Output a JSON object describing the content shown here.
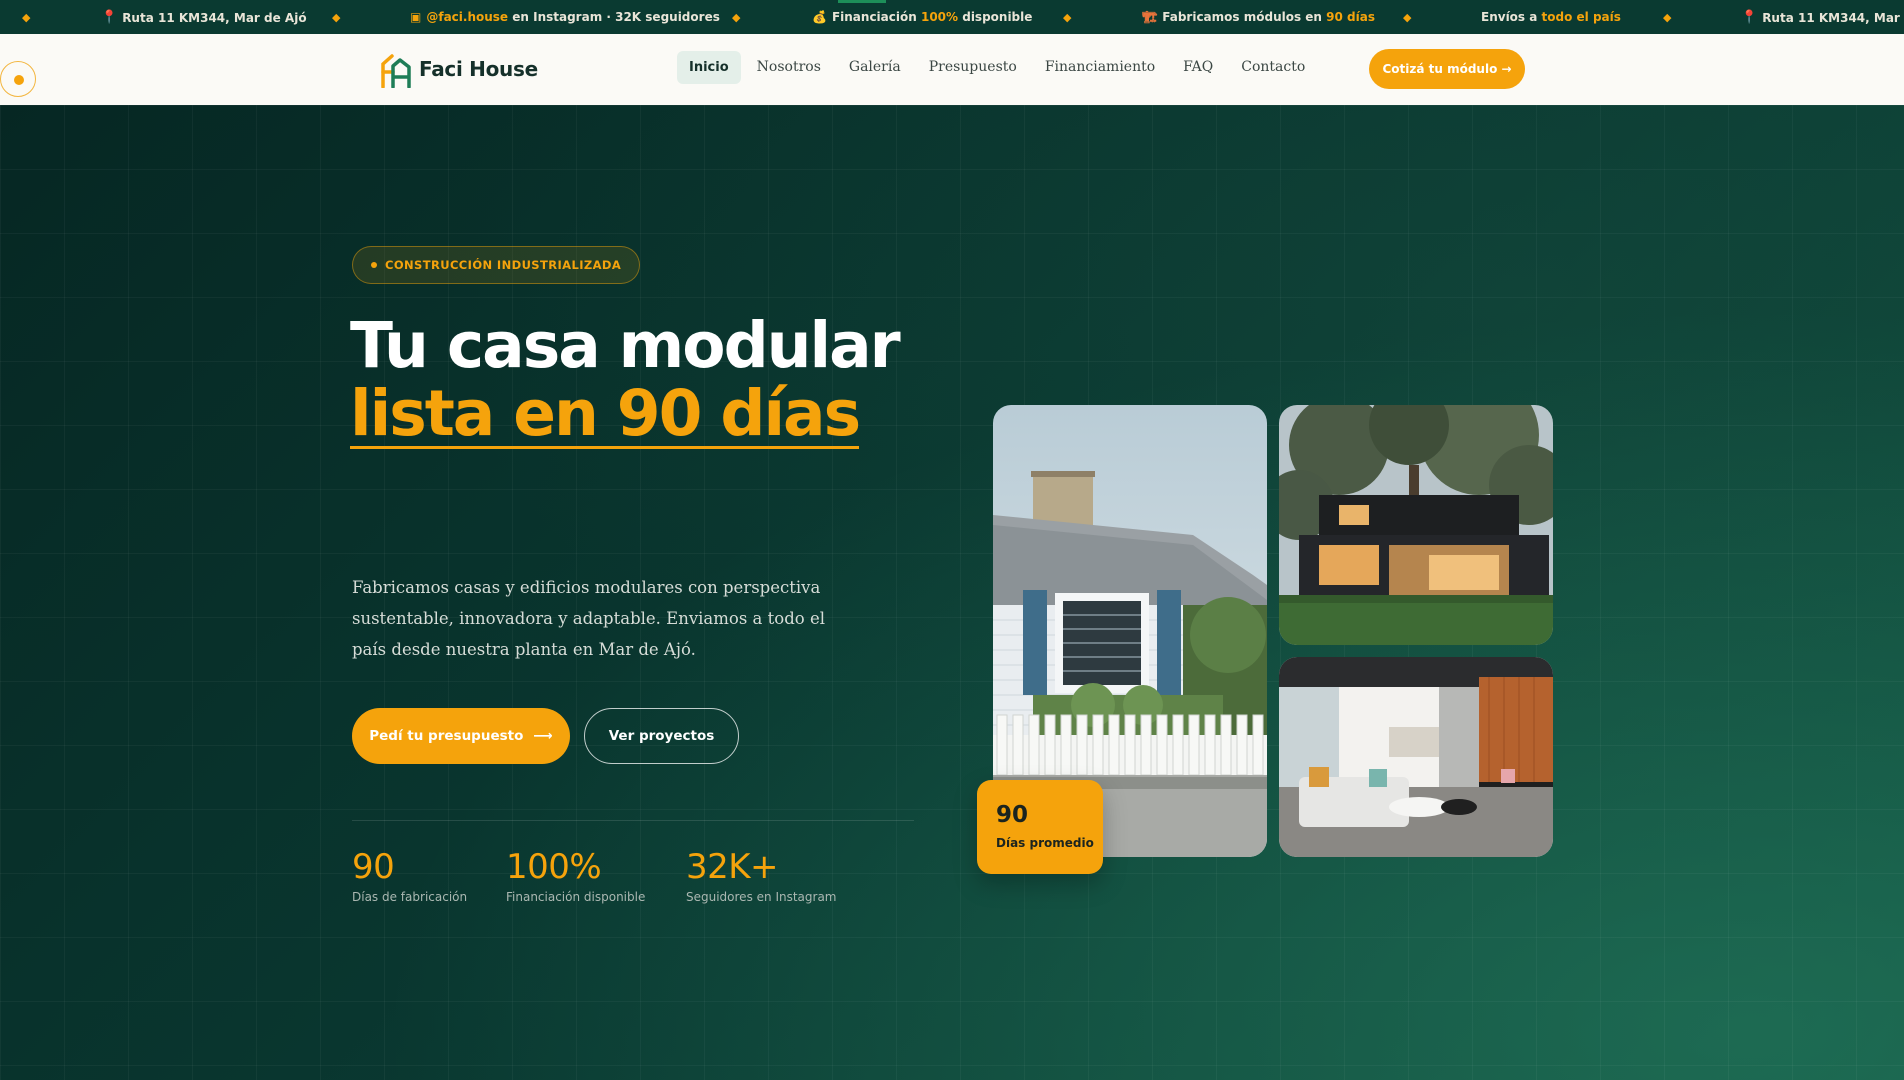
{
  "ticker": {
    "items": [
      {
        "icon": "pin-icon",
        "parts": [
          {
            "text": "Ruta 11 KM344, Mar de Ajó",
            "hl": false
          }
        ]
      },
      {
        "icon": "instagram-icon",
        "parts": [
          {
            "text": "@faci.house",
            "hl": true
          },
          {
            "text": " en Instagram · 32K seguidores",
            "hl": false
          }
        ]
      },
      {
        "icon": "money-bag-icon",
        "parts": [
          {
            "text": "Financiación ",
            "hl": false
          },
          {
            "text": "100%",
            "hl": true
          },
          {
            "text": " disponible",
            "hl": false
          }
        ]
      },
      {
        "icon": "crane-icon",
        "parts": [
          {
            "text": "Fabricamos módulos en ",
            "hl": false
          },
          {
            "text": "90 días",
            "hl": true
          }
        ]
      },
      {
        "icon": "",
        "parts": [
          {
            "text": "Envíos a ",
            "hl": false
          },
          {
            "text": "todo el país",
            "hl": true
          }
        ]
      },
      {
        "icon": "pin-icon",
        "parts": [
          {
            "text": "Ruta 11 KM344, Mar de Ajó",
            "hl": false
          }
        ]
      }
    ]
  },
  "header": {
    "brand": "Faci House",
    "nav": [
      {
        "label": "Inicio",
        "active": true
      },
      {
        "label": "Nosotros",
        "active": false
      },
      {
        "label": "Galería",
        "active": false
      },
      {
        "label": "Presupuesto",
        "active": false
      },
      {
        "label": "Financiamiento",
        "active": false
      },
      {
        "label": "FAQ",
        "active": false
      },
      {
        "label": "Contacto",
        "active": false
      }
    ],
    "cta": "Cotizá tu módulo →"
  },
  "hero": {
    "badge": "CONSTRUCCIÓN INDUSTRIALIZADA",
    "title_line1": "Tu casa modular",
    "title_line2": "lista en 90 días",
    "lead": "Fabricamos casas y edificios modulares con perspectiva sustentable, innovadora y adaptable. Enviamos a todo el país desde nuestra planta en Mar de Ajó.",
    "primary_button": "Pedí tu presupuesto",
    "secondary_button": "Ver proyectos",
    "stats": [
      {
        "value": "90",
        "label": "Días de fabricación"
      },
      {
        "value": "100%",
        "label": "Financiación disponible"
      },
      {
        "value": "32K+",
        "label": "Seguidores en Instagram"
      }
    ],
    "days_card": {
      "value": "90",
      "label": "Días promedio"
    }
  },
  "colors": {
    "accent": "#f5a30c",
    "dark_green": "#06302a",
    "header_bg": "#fbfaf6"
  }
}
